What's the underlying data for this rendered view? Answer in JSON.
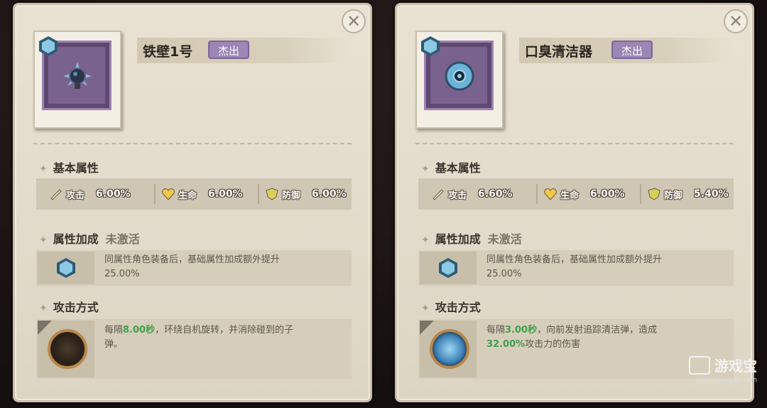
{
  "cards": [
    {
      "name": "铁壁1号",
      "rarity": "杰出",
      "stats_title": "基本属性",
      "stats": [
        {
          "label": "攻击",
          "value": "6.00%"
        },
        {
          "label": "生命",
          "value": "6.00%"
        },
        {
          "label": "防御",
          "value": "6.00%"
        }
      ],
      "bonus_title": "属性加成",
      "bonus_status": "未激活",
      "bonus_desc": "同属性角色装备后，基础属性加成额外提升",
      "bonus_value": "25.00%",
      "attack_title": "攻击方式",
      "attack_desc_pre": "每隔",
      "attack_highlight": "8.00秒",
      "attack_desc_post": "，环绕自机旋转，并消除碰到的子",
      "attack_desc_line2_pre": "弹。",
      "attack_highlight2": "",
      "attack_desc_line2_post": ""
    },
    {
      "name": "口臭清洁器",
      "rarity": "杰出",
      "stats_title": "基本属性",
      "stats": [
        {
          "label": "攻击",
          "value": "6.60%"
        },
        {
          "label": "生命",
          "value": "6.00%"
        },
        {
          "label": "防御",
          "value": "5.40%"
        }
      ],
      "bonus_title": "属性加成",
      "bonus_status": "未激活",
      "bonus_desc": "同属性角色装备后，基础属性加成额外提升",
      "bonus_value": "25.00%",
      "attack_title": "攻击方式",
      "attack_desc_pre": "每隔",
      "attack_highlight": "3.00秒",
      "attack_desc_post": "，向前发射追踪清洁弹，造成",
      "attack_desc_line2_pre": "",
      "attack_highlight2": "32.00%",
      "attack_desc_line2_post": "攻击力的伤害"
    }
  ],
  "close_label": "✕",
  "watermark": {
    "brand": "游戏宝",
    "url": "www.youxibao.com"
  },
  "colors": {
    "rarity": "#9b86b6",
    "highlight": "#3e9f4b",
    "icon_bg": "#7a628e"
  }
}
